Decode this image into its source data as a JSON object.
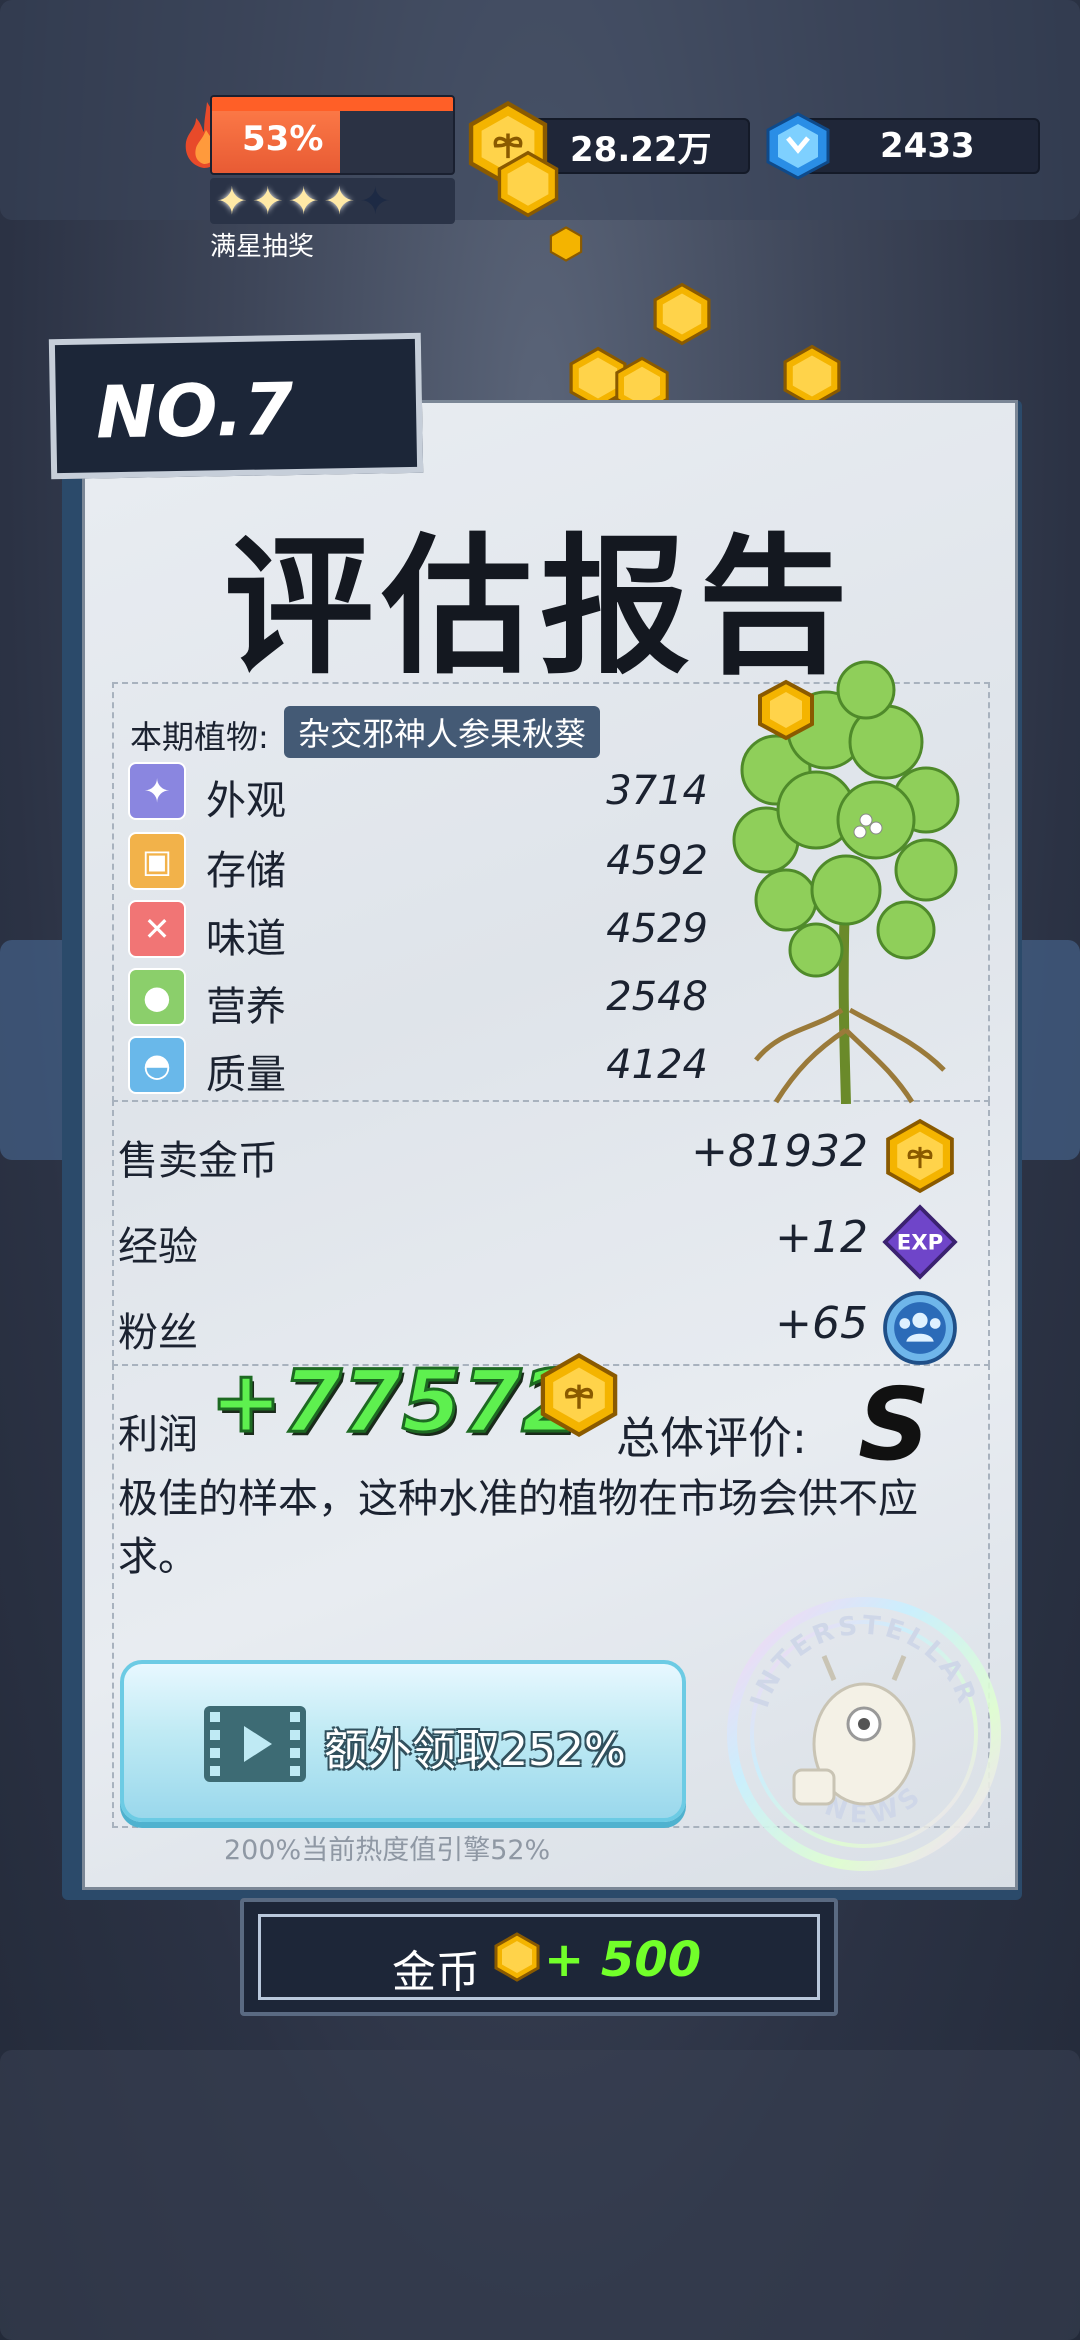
{
  "hud": {
    "heat_percent": "53%",
    "heat_level": 0.53,
    "stars_filled": 4,
    "stars_total": 5,
    "star_label": "满星抽奖",
    "coins": "28.22万",
    "gems": "2433"
  },
  "report": {
    "number": "NO.7",
    "title": "评估报告",
    "plant_label": "本期植物:",
    "plant_name": "杂交邪神人参果秋葵",
    "attributes": [
      {
        "icon": "sparkle-icon",
        "label": "外观",
        "value": "3714",
        "color": "#8a86e0"
      },
      {
        "icon": "box-icon",
        "label": "存储",
        "value": "4592",
        "color": "#f2b24a"
      },
      {
        "icon": "utensils-icon",
        "label": "味道",
        "value": "4529",
        "color": "#f17575"
      },
      {
        "icon": "apple-icon",
        "label": "营养",
        "value": "2548",
        "color": "#8bcf6b"
      },
      {
        "icon": "muscle-icon",
        "label": "质量",
        "value": "4124",
        "color": "#69b8ea"
      }
    ],
    "rewards": [
      {
        "label": "售卖金币",
        "value": "+81932",
        "icon": "coin-icon"
      },
      {
        "label": "经验",
        "value": "+12",
        "icon": "exp-icon",
        "icon_text": "EXP"
      },
      {
        "label": "粉丝",
        "value": "+65",
        "icon": "fans-icon"
      }
    ],
    "profit_label": "利润",
    "profit_value": "+77572",
    "grade_label": "总体评价:",
    "grade": "S",
    "comment": "极佳的样本，这种水准的植物在市场会供不应求。",
    "ad_button": "额外领取252%",
    "ad_note": "200%当前热度值引擎52%",
    "stamp_top": "INTERSTELLAR",
    "stamp_bottom": "NEWS"
  },
  "footer": {
    "label": "金币",
    "amount": "+ 500"
  }
}
